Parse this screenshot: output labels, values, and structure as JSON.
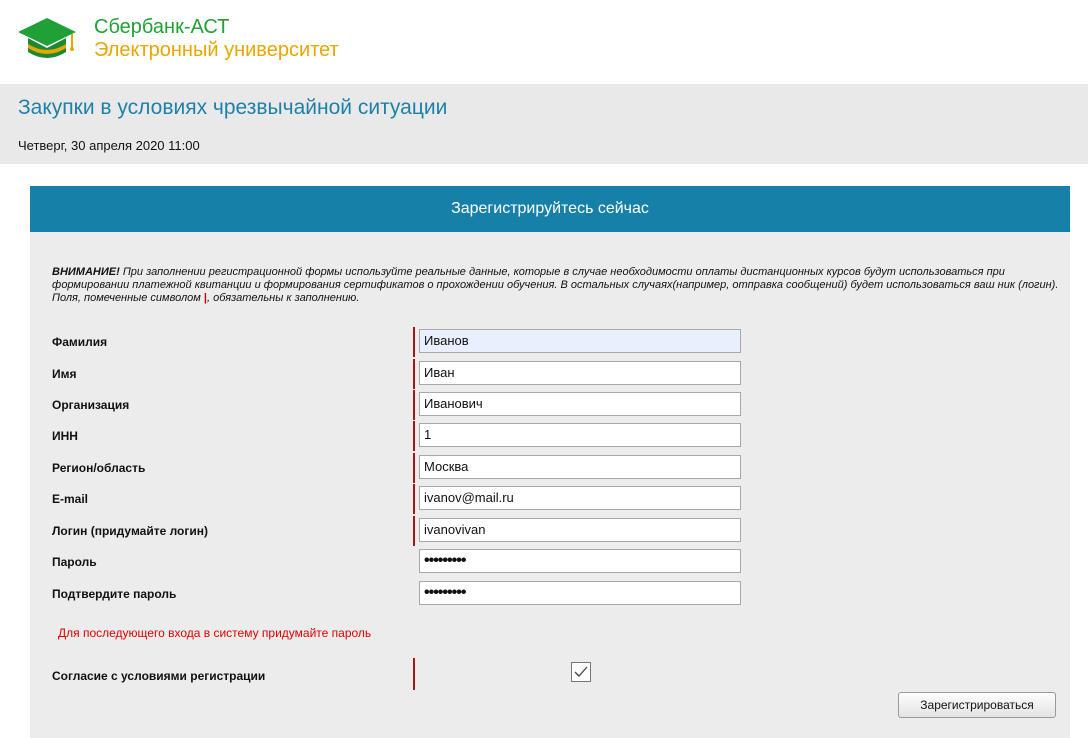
{
  "logo": {
    "line1": "Сбербанк-АСТ",
    "line2": "Электронный университет"
  },
  "header": {
    "title": "Закупки в условиях чрезвычайной ситуации",
    "date": "Четверг, 30 апреля 2020 11:00"
  },
  "registration": {
    "heading": "Зарегистрируйтесь сейчас",
    "notice_bold": "ВНИМАНИЕ!",
    "notice_text": " При заполнении регистрационной формы используйте реальные данные, которые в случае необходимости оплаты дистанционных курсов будут использоваться при формировании платежной квитанции и формирования сертификатов о прохождении обучения. В остальных случаях(например, отправка сообщений) будет использоваться ваш ник (логин). Поля, помеченные символом ",
    "notice_mark": "|",
    "notice_tail": ", обязательны к заполнению.",
    "fields": [
      {
        "label": "Фамилия",
        "value": "Иванов"
      },
      {
        "label": "Имя",
        "value": "Иван"
      },
      {
        "label": "Организация",
        "value": "Иванович"
      },
      {
        "label": "ИНН",
        "value": "1"
      },
      {
        "label": "Регион/область",
        "value": "Москва"
      },
      {
        "label": "E-mail",
        "value": "ivanov@mail.ru"
      },
      {
        "label": "Логин (придумайте логин)",
        "value": "ivanovivan"
      },
      {
        "label": "Пароль",
        "value": "•••••••••"
      },
      {
        "label": "Подтвердите пароль",
        "value": "•••••••••"
      }
    ],
    "password_hint": "Для последующего входа в систему придумайте пароль",
    "consent_label": "Согласие с условиями регистрации",
    "consent_checked": true,
    "submit_label": "Зарегистрироваться"
  },
  "colors": {
    "brand_green": "#21a038",
    "brand_yellow": "#e8a600",
    "header_blue": "#1780a9",
    "required_mark": "#a4161a",
    "hint_red": "#e00000"
  }
}
